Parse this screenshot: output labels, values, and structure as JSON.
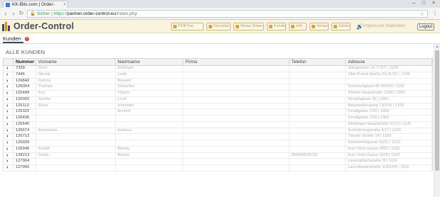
{
  "browser": {
    "tab_title": "KK-Bits.com | Order-",
    "tab_close": "×",
    "win_min": "–",
    "win_max": "□",
    "win_close": "×",
    "back": "‹",
    "forward": "›",
    "reload": "↻",
    "lock": "🔒",
    "secure_label": "Sicher",
    "separator": " | ",
    "url_protocol": "https://",
    "url_host": "partner.order-control.eu",
    "url_path": "/index.php",
    "star": "☆",
    "menu": "⋮"
  },
  "app": {
    "title": "Order-Control",
    "toolbar": [
      {
        "label": "PDA Fax"
      },
      {
        "label": "Druckdat"
      },
      {
        "label": "Meine Daten"
      },
      {
        "label": "Kunden"
      },
      {
        "label": "Info"
      },
      {
        "label": "Verlauf"
      },
      {
        "label": "Zahlen"
      }
    ],
    "speaker_icon": "🔊",
    "impressum": "Impressum Statistiken",
    "logout_label": "Logout"
  },
  "subtabs": {
    "kunden_label": "Kunden",
    "close": "×"
  },
  "section_title": "ALLE KUNDEN",
  "table": {
    "headers": {
      "num": "Nummer",
      "vorname": "Vorname",
      "nachname": "Nachname",
      "firma": "Firma",
      "telefon": "Telefon",
      "adresse": "Adresse"
    },
    "expand_glyph": "›",
    "rows": [
      {
        "num": "7339",
        "vorname": "Doris",
        "nachname": "Schlinger",
        "firma": "",
        "telefon": "",
        "adresse": "Salzgrieswe 14 /7 /ST. | 1120"
      },
      {
        "num": "7446",
        "vorname": "Nikolai",
        "nachname": "Lonik",
        "firma": "",
        "telefon": "",
        "adresse": "Obir-Probst-Straße 23 /8 /ST. | 1100"
      },
      {
        "num": "124842",
        "vorname": "Damira",
        "nachname": "Beward",
        "firma": "",
        "telefon": "",
        "adresse": ""
      },
      {
        "num": "125054",
        "vorname": "Thomas",
        "nachname": "Ostracher",
        "firma": "",
        "telefon": "",
        "adresse": "Rotenhofgasse 80 /94/3/4 | 1100"
      },
      {
        "num": "125499",
        "vorname": "Eric",
        "nachname": "Vilgren",
        "firma": "",
        "telefon": "",
        "adresse": "Kleiner Hauptstraße 118/5 | 1050"
      },
      {
        "num": "126002",
        "vorname": "Sandro",
        "nachname": "Lucik",
        "firma": "",
        "telefon": "",
        "adresse": "Neulahgasse 35 | 1050"
      },
      {
        "num": "126113",
        "vorname": "Maria",
        "nachname": "schmidler",
        "firma": "",
        "telefon": "",
        "adresse": "Bergsiedlungweg 73/3/16 | 1100"
      },
      {
        "num": "126322",
        "vorname": "",
        "nachname": "ferment",
        "firma": "",
        "telefon": "",
        "adresse": "Fendtgasse 23/5 | 1050"
      },
      {
        "num": "126436",
        "vorname": "",
        "nachname": "",
        "firma": "",
        "telefon": "",
        "adresse": "Fendtgasse 23/5 | 1050"
      },
      {
        "num": "126540",
        "vorname": "",
        "nachname": "",
        "firma": "",
        "telefon": "",
        "adresse": "Meidlinger Hauptstraße 67/12 | 1120"
      },
      {
        "num": "126674",
        "vorname": "Annamaria",
        "nachname": "berkova",
        "firma": "",
        "telefon": "",
        "adresse": "Schönbrungstraße 4/17 | 1040"
      },
      {
        "num": "126712",
        "vorname": "",
        "nachname": "",
        "firma": "",
        "telefon": "",
        "adresse": "Triester Straße 14 | 1100"
      },
      {
        "num": "126939",
        "vorname": "",
        "nachname": "",
        "firma": "",
        "telefon": "",
        "adresse": "Kistenmühlgasse 63/31 | 1120"
      },
      {
        "num": "126946",
        "vorname": "Rudolf",
        "nachname": "Bilasky",
        "firma": "",
        "telefon": "",
        "adresse": "Kurt-Tichy-Gasse 3/8/2 | 1100"
      },
      {
        "num": "128213",
        "vorname": "Golab",
        "nachname": "Neoria",
        "firma": "",
        "telefon": "069048636136",
        "adresse": "Kurt-Tichy-Gasse 3/2/8 | 1100"
      },
      {
        "num": "127004",
        "vorname": "",
        "nachname": "",
        "firma": "",
        "telefon": "",
        "adresse": "Leesingbachstraße 3t | 1100"
      },
      {
        "num": "127050",
        "vorname": "",
        "nachname": "",
        "firma": "",
        "telefon": "",
        "adresse": "Laxenburgerstraße 109/14/5 | 1100"
      }
    ]
  }
}
